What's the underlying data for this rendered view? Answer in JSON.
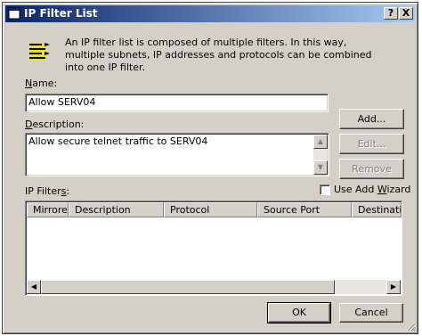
{
  "window": {
    "title": "IP Filter List",
    "help_button": "?",
    "close_button": "X"
  },
  "intro": {
    "text": "An IP filter list is composed of multiple filters. In this way, multiple subnets, IP addresses and protocols can be combined into one IP filter."
  },
  "name": {
    "label_key": "N",
    "label_rest": "ame:",
    "value": "Allow SERV04"
  },
  "description": {
    "label_key": "D",
    "label_rest": "escription:",
    "value": "Allow secure telnet traffic to SERV04"
  },
  "buttons": {
    "add": "Add...",
    "edit": "Edit...",
    "remove": "Remove",
    "ok": "OK",
    "cancel": "Cancel"
  },
  "ip_filters": {
    "label_pre": "IP Filter",
    "label_key": "s",
    "label_post": ":",
    "use_wizard_pre": "Use Add ",
    "use_wizard_key": "W",
    "use_wizard_post": "izard",
    "use_wizard_checked": false,
    "columns": [
      "Mirrored",
      "Description",
      "Protocol",
      "Source Port",
      "Destination"
    ],
    "rows": []
  },
  "colors": {
    "title_start": "#0a246a",
    "title_end": "#a6caf0",
    "dialog_face": "#d4d0c8",
    "icon_yellow": "#f2e600"
  }
}
